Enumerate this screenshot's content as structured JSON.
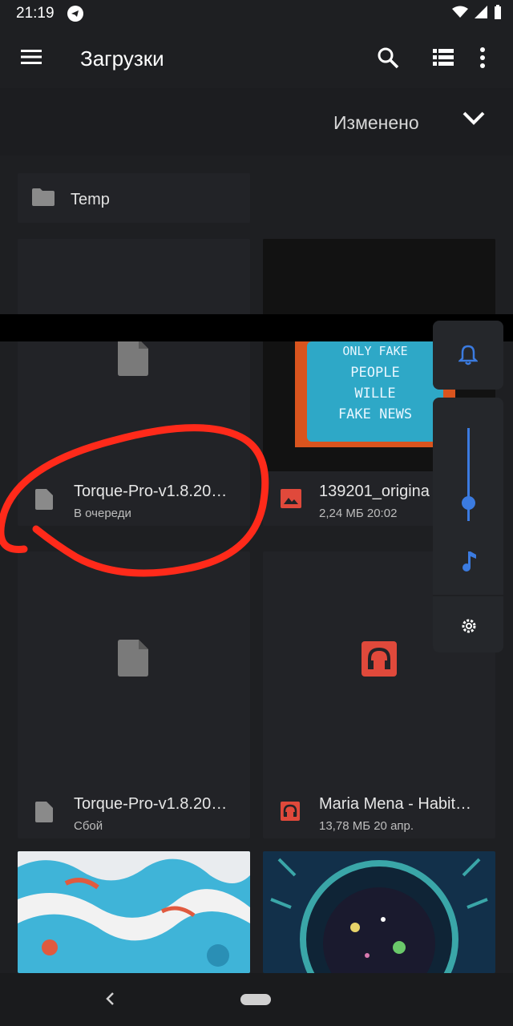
{
  "status": {
    "time": "21:19"
  },
  "appbar": {
    "title": "Загрузки"
  },
  "sort": {
    "label": "Изменено"
  },
  "folder": {
    "name": "Temp"
  },
  "files": [
    {
      "name": "Torque-Pro-v1.8.20…",
      "sub": "В очереди",
      "icon": "file-icon"
    },
    {
      "name": "139201_origina",
      "sub": "2,24 МБ 20:02",
      "icon": "image-icon"
    },
    {
      "name": "Torque-Pro-v1.8.20…",
      "sub": "Сбой",
      "icon": "file-icon"
    },
    {
      "name": "Maria Mena - Habit…",
      "sub": "13,78 МБ 20 апр.",
      "icon": "headphones-icon"
    }
  ],
  "thumbnail_text": [
    "ONLY FAKE",
    "PEOPLE",
    "WILLE",
    "FAKE NEWS"
  ],
  "colors": {
    "accent": "#3b7be0",
    "audio": "#e0493b",
    "image": "#e0493b",
    "annotation": "#ff2a1a"
  }
}
